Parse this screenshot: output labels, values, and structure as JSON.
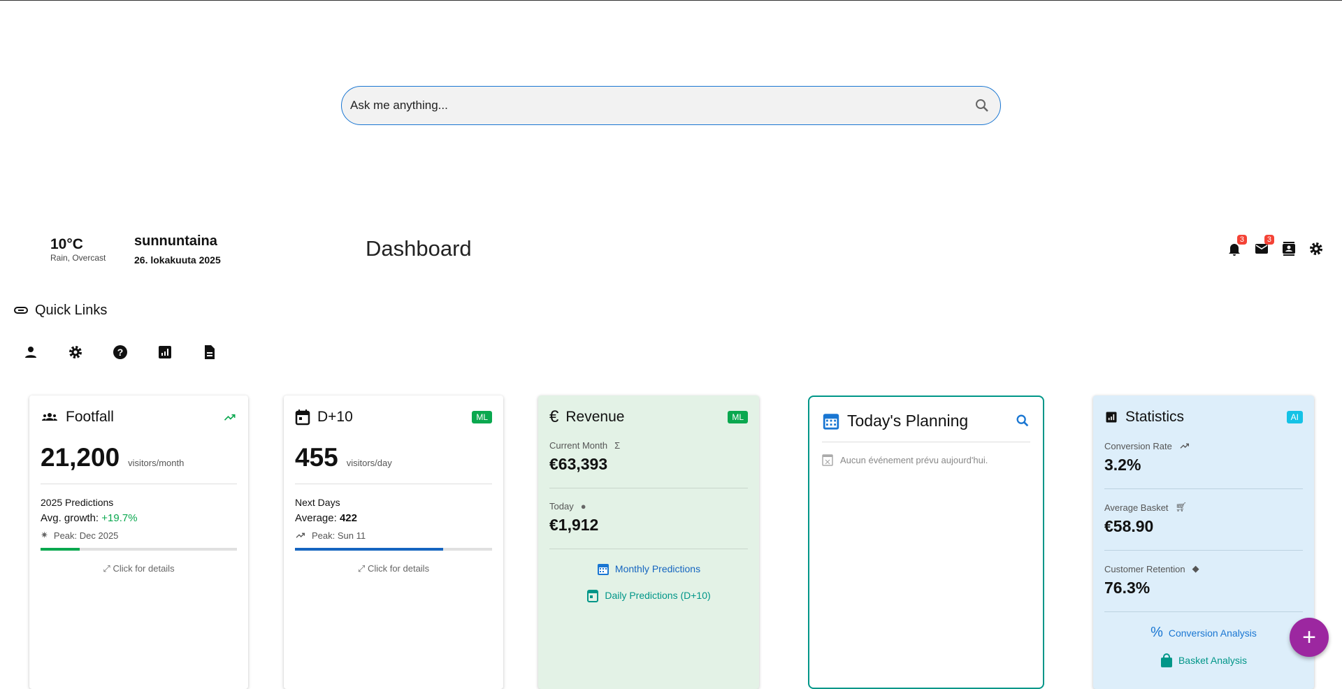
{
  "search": {
    "placeholder": "Ask me anything..."
  },
  "weather": {
    "temp": "10°C",
    "condition": "Rain, Overcast"
  },
  "date": {
    "weekday": "sunnuntaina",
    "full": "26. lokakuuta 2025"
  },
  "header": {
    "title": "Dashboard",
    "notifications_count": "3",
    "messages_count": "3"
  },
  "quick_links": {
    "title": "Quick Links"
  },
  "footfall": {
    "title": "Footfall",
    "value": "21,200",
    "unit": "visitors/month",
    "sub_title": "2025 Predictions",
    "growth_label": "Avg. growth:",
    "growth_value": "+19.7%",
    "peak": "Peak: Dec 2025",
    "progress": 0.2,
    "details": "Click for details"
  },
  "d10": {
    "title": "D+10",
    "badge": "ML",
    "value": "455",
    "unit": "visitors/day",
    "sub_title": "Next Days",
    "avg_label": "Average:",
    "avg_value": "422",
    "peak": "Peak: Sun 11",
    "progress": 0.75,
    "details": "Click for details"
  },
  "revenue": {
    "title": "Revenue",
    "badge": "ML",
    "month_label": "Current Month",
    "month_value": "€63,393",
    "today_label": "Today",
    "today_value": "€1,912",
    "link_monthly": "Monthly Predictions",
    "link_daily": "Daily Predictions (D+10)"
  },
  "planning": {
    "title": "Today's Planning",
    "empty": "Aucun événement prévu aujourd'hui."
  },
  "statistics": {
    "title": "Statistics",
    "badge": "AI",
    "conv_label": "Conversion Rate",
    "conv_value": "3.2%",
    "basket_label": "Average Basket",
    "basket_value": "€58.90",
    "ret_label": "Customer Retention",
    "ret_value": "76.3%",
    "link_conv": "Conversion Analysis",
    "link_basket": "Basket Analysis"
  },
  "fab": {
    "label": "+"
  },
  "colors": {
    "accent": "#1976d2",
    "green": "#0aa84f",
    "teal": "#009688",
    "purple": "#9c27a0"
  }
}
